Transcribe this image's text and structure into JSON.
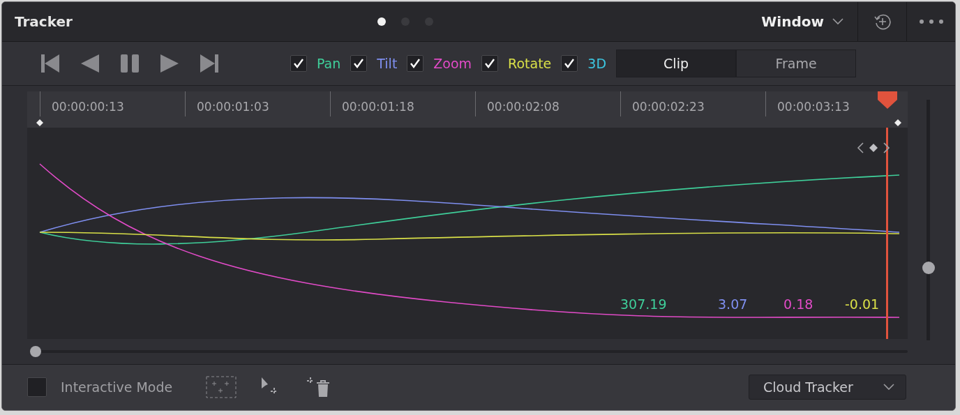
{
  "panel": {
    "title": "Tracker",
    "pages": [
      {
        "selected": true
      },
      {
        "selected": false
      },
      {
        "selected": false
      }
    ],
    "window_menu": "Window"
  },
  "channels": [
    {
      "name": "Pan",
      "checked": true,
      "color": "#3fcf9a",
      "reading": "307.19"
    },
    {
      "name": "Tilt",
      "checked": true,
      "color": "#7f8ff0",
      "reading": "3.07"
    },
    {
      "name": "Zoom",
      "checked": true,
      "color": "#e24bc8",
      "reading": "0.18"
    },
    {
      "name": "Rotate",
      "checked": true,
      "color": "#d9e048",
      "reading": "-0.01"
    },
    {
      "name": "3D",
      "checked": true,
      "color": "#3cc6e0"
    }
  ],
  "modes": [
    {
      "label": "Clip",
      "selected": true
    },
    {
      "label": "Frame",
      "selected": false
    }
  ],
  "timeline": {
    "timecodes": [
      "00:00:00:13",
      "00:00:01:03",
      "00:00:01:18",
      "00:00:02:08",
      "00:00:02:23",
      "00:00:03:13"
    ]
  },
  "zoom_slider": {
    "level": 0.3
  },
  "footer": {
    "interactive_mode": {
      "label": "Interactive Mode",
      "checked": false
    },
    "tracker_menu": "Cloud Tracker"
  }
}
